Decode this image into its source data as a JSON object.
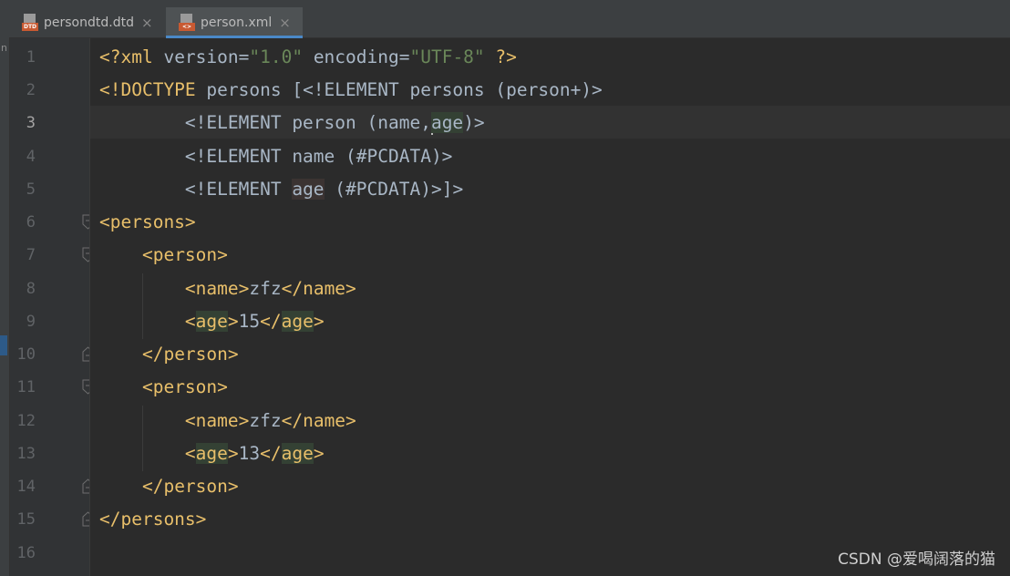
{
  "tabs": [
    {
      "label": "persondtd.dtd",
      "icon": "dtd-file-icon",
      "close": "×",
      "icon_badge": "DTD"
    },
    {
      "label": "person.xml",
      "icon": "xml-file-icon",
      "close": "×",
      "icon_badge": "<>",
      "active": true
    }
  ],
  "gutter": {
    "line_numbers": [
      "1",
      "2",
      "3",
      "4",
      "5",
      "6",
      "7",
      "8",
      "9",
      "10",
      "11",
      "12",
      "13",
      "14",
      "15",
      "16"
    ],
    "current_line": "3"
  },
  "code": {
    "l1": {
      "a": "<?xml ",
      "b": "version=",
      "c": "\"1.0\"",
      "d": " encoding=",
      "e": "\"UTF-8\"",
      "f": " ?>"
    },
    "l2": {
      "a": "<!DOCTYPE",
      "b": " persons [<!ELEMENT persons (person+)>"
    },
    "l3": {
      "indent": "        ",
      "a": "<!ELEMENT person (name,",
      "b": "age",
      "c": ")>"
    },
    "l4": {
      "indent": "        ",
      "a": "<!ELEMENT name (#PCDATA)>"
    },
    "l5": {
      "indent": "        ",
      "a": "<!ELEMENT ",
      "b": "age",
      "c": " (#PCDATA)>]>"
    },
    "l6": {
      "a": "<persons>"
    },
    "l7": {
      "indent": "    ",
      "a": "<person>"
    },
    "l8": {
      "indent": "        ",
      "a": "<name>",
      "b": "zfz",
      "c": "</name>"
    },
    "l9": {
      "indent": "        ",
      "a": "<",
      "b": "age",
      "c": ">",
      "d": "15",
      "e": "</",
      "f": "age",
      "g": ">"
    },
    "l10": {
      "indent": "    ",
      "a": "</person>"
    },
    "l11": {
      "indent": "    ",
      "a": "<person>"
    },
    "l12": {
      "indent": "        ",
      "a": "<name>",
      "b": "zfz",
      "c": "</name>"
    },
    "l13": {
      "indent": "        ",
      "a": "<",
      "b": "age",
      "c": ">",
      "d": "13",
      "e": "</",
      "f": "age",
      "g": ">"
    },
    "l14": {
      "indent": "    ",
      "a": "</person>"
    },
    "l15": {
      "a": "</persons>"
    },
    "l16": {
      "a": ""
    }
  },
  "watermark": "CSDN @爱喝阔落的猫",
  "colors": {
    "background": "#2b2b2b",
    "tag": "#e8bf6a",
    "string": "#6a8759",
    "text": "#a9b7c6",
    "active_tab_underline": "#4a88c7"
  }
}
